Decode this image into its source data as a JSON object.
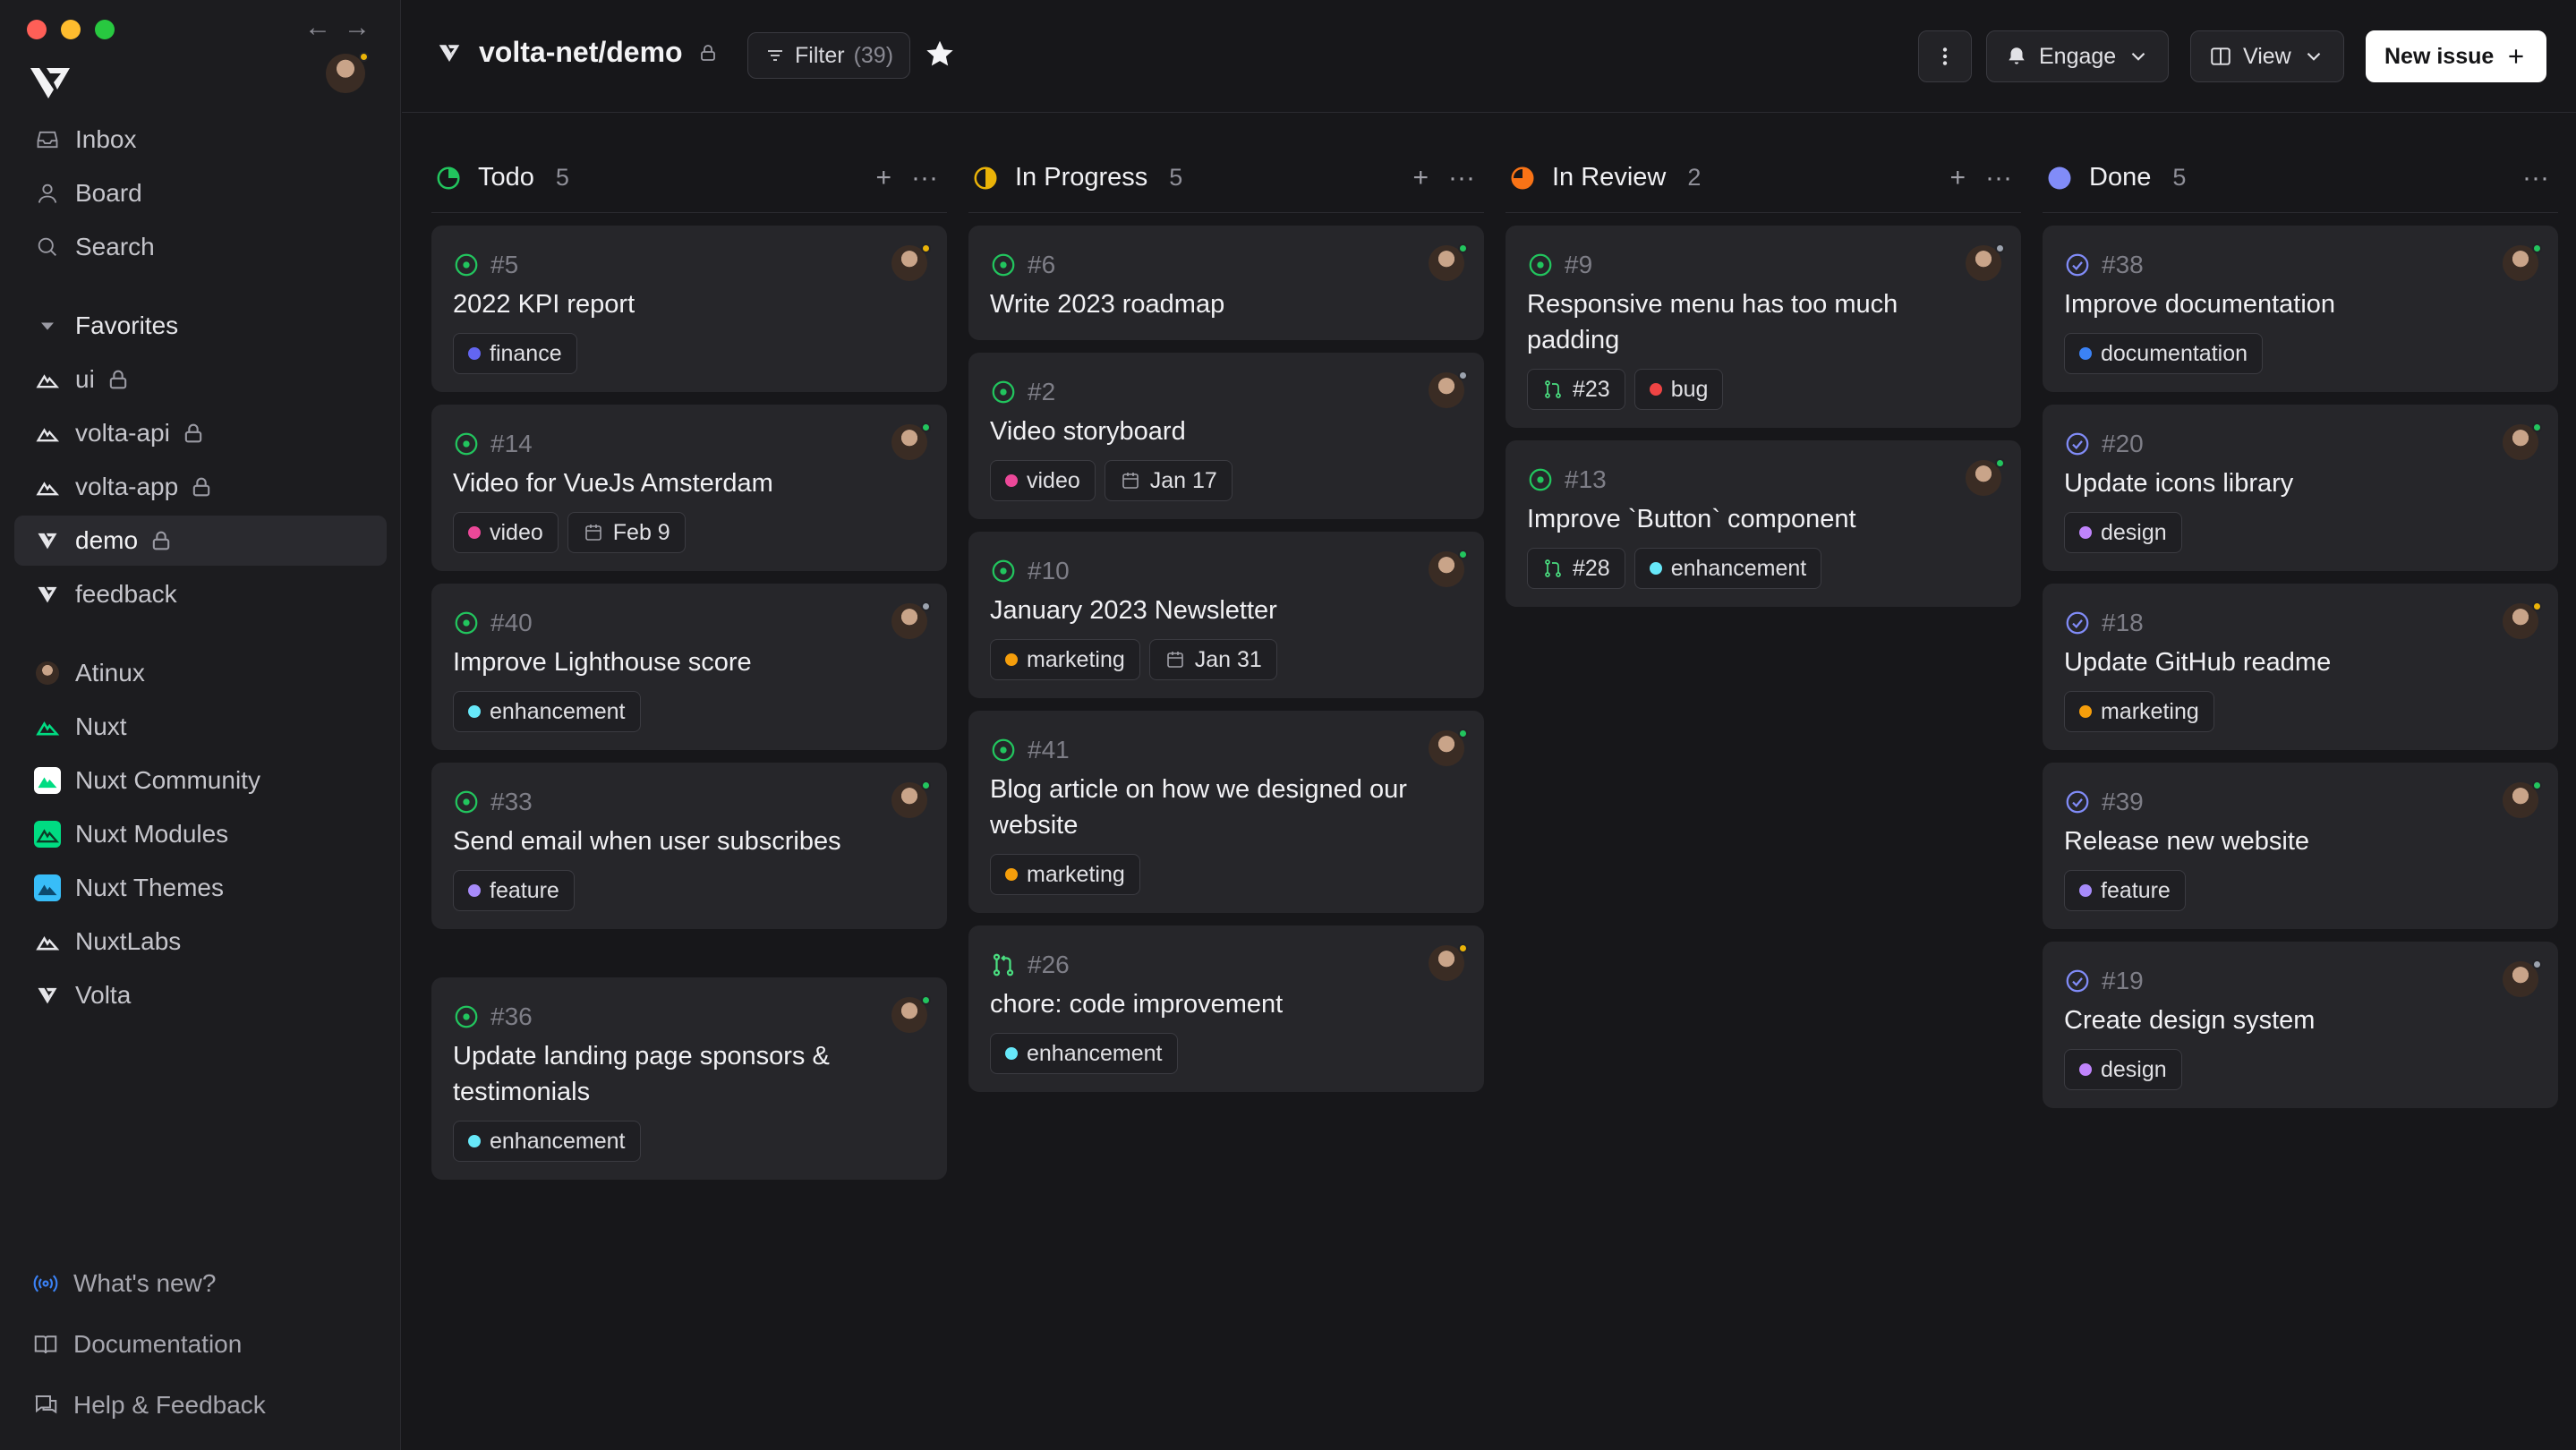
{
  "window": {
    "traffic_colors": [
      "#ff5f57",
      "#febc2e",
      "#28c840"
    ]
  },
  "sidebar": {
    "main": [
      {
        "label": "Inbox",
        "icon": "inbox-icon"
      },
      {
        "label": "Board",
        "icon": "user-icon"
      },
      {
        "label": "Search",
        "icon": "search-icon"
      }
    ],
    "favorites_label": "Favorites",
    "favorites": [
      {
        "label": "ui",
        "locked": true
      },
      {
        "label": "volta-api",
        "locked": true
      },
      {
        "label": "volta-app",
        "locked": true
      },
      {
        "label": "demo",
        "locked": true,
        "active": true
      },
      {
        "label": "feedback",
        "locked": false
      }
    ],
    "orgs": [
      {
        "label": "Atinux"
      },
      {
        "label": "Nuxt"
      },
      {
        "label": "Nuxt Community"
      },
      {
        "label": "Nuxt Modules"
      },
      {
        "label": "Nuxt Themes"
      },
      {
        "label": "NuxtLabs"
      },
      {
        "label": "Volta"
      }
    ],
    "bottom": [
      {
        "label": "What's new?",
        "icon": "broadcast-icon"
      },
      {
        "label": "Documentation",
        "icon": "book-icon"
      },
      {
        "label": "Help & Feedback",
        "icon": "chat-icon"
      }
    ]
  },
  "header": {
    "repo": "volta-net/demo",
    "filter_label": "Filter",
    "filter_count": "(39)",
    "engage_label": "Engage",
    "view_label": "View",
    "new_issue_label": "New issue"
  },
  "columns": [
    {
      "title": "Todo",
      "count": "5",
      "status_color": "#22c55e",
      "cards": [
        {
          "id": "#5",
          "title": "2022 KPI report",
          "tags": [
            {
              "label": "finance",
              "color": "#6366f1"
            }
          ]
        },
        {
          "id": "#14",
          "title": "Video for VueJs Amsterdam",
          "tags": [
            {
              "label": "video",
              "color": "#ec4899"
            }
          ],
          "date": "Feb 9"
        },
        {
          "id": "#40",
          "title": "Improve Lighthouse score",
          "tags": [
            {
              "label": "enhancement",
              "color": "#67e8f9"
            }
          ]
        },
        {
          "id": "#33",
          "title": "Send email when user subscribes",
          "tags": [
            {
              "label": "feature",
              "color": "#a78bfa"
            }
          ]
        },
        {
          "id": "#36",
          "title": "Update landing page sponsors & testimonials",
          "tags": [
            {
              "label": "enhancement",
              "color": "#67e8f9"
            }
          ]
        }
      ]
    },
    {
      "title": "In Progress",
      "count": "5",
      "status_color": "#eab308",
      "cards": [
        {
          "id": "#6",
          "title": "Write 2023 roadmap",
          "tags": []
        },
        {
          "id": "#2",
          "title": "Video storyboard",
          "tags": [
            {
              "label": "video",
              "color": "#ec4899"
            }
          ],
          "date": "Jan 17"
        },
        {
          "id": "#10",
          "title": "January 2023 Newsletter",
          "tags": [
            {
              "label": "marketing",
              "color": "#f59e0b"
            }
          ],
          "date": "Jan 31"
        },
        {
          "id": "#41",
          "title": "Blog article on how we designed our website",
          "tags": [
            {
              "label": "marketing",
              "color": "#f59e0b"
            }
          ]
        },
        {
          "id": "#26",
          "title": "chore: code improvement",
          "tags": [
            {
              "label": "enhancement",
              "color": "#67e8f9"
            }
          ],
          "pr": true
        }
      ]
    },
    {
      "title": "In Review",
      "count": "2",
      "status_color": "#f97316",
      "cards": [
        {
          "id": "#9",
          "title": "Responsive menu has too much padding",
          "pr_ref": "#23",
          "tags": [
            {
              "label": "bug",
              "color": "#ef4444"
            }
          ]
        },
        {
          "id": "#13",
          "title": "Improve `Button` component",
          "pr_ref": "#28",
          "tags": [
            {
              "label": "enhancement",
              "color": "#67e8f9"
            }
          ]
        }
      ]
    },
    {
      "title": "Done",
      "count": "5",
      "status_color": "#818cf8",
      "cards": [
        {
          "id": "#38",
          "title": "Improve documentation",
          "tags": [
            {
              "label": "documentation",
              "color": "#3b82f6"
            }
          ]
        },
        {
          "id": "#20",
          "title": "Update icons library",
          "tags": [
            {
              "label": "design",
              "color": "#c084fc"
            }
          ]
        },
        {
          "id": "#18",
          "title": "Update GitHub readme",
          "tags": [
            {
              "label": "marketing",
              "color": "#f59e0b"
            }
          ]
        },
        {
          "id": "#39",
          "title": "Release new website",
          "tags": [
            {
              "label": "feature",
              "color": "#a78bfa"
            }
          ]
        },
        {
          "id": "#19",
          "title": "Create design system",
          "tags": [
            {
              "label": "design",
              "color": "#c084fc"
            }
          ]
        }
      ]
    }
  ]
}
